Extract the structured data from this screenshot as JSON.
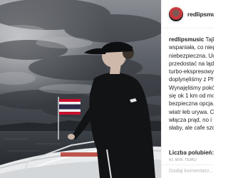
{
  "post": {
    "username": "redlipsmusic",
    "caption_lines": [
      {
        "user": "redlipsmusic",
        "text": " Tajlan"
      },
      {
        "text": "wspaniała, co niep"
      },
      {
        "text": "niebezpieczna. Uda"
      },
      {
        "text": "przedostać na ląd"
      },
      {
        "text": "turbo-ekspresowy"
      },
      {
        "text": "doplynęliśmy z Ph"
      },
      {
        "text": "Wynajęliśmy pokój"
      },
      {
        "text": "się ok 1 km od mo"
      },
      {
        "text": "bezpieczna opcja."
      },
      {
        "text": "wiatr łeb urywa. C"
      },
      {
        "text": "włącza prąd, no i"
      },
      {
        "text": "słaby, ale cafe szcz"
      }
    ],
    "likes_label": "Liczba polubień: 2",
    "timestamp": "41 MIN TEMU",
    "comment_placeholder": "Dodaj komentarz..."
  },
  "colors": {
    "text": "#262626",
    "muted": "#999999",
    "divider": "#efefef",
    "flag_red": "#c8102e",
    "flag_blue": "#2d2a4a"
  }
}
